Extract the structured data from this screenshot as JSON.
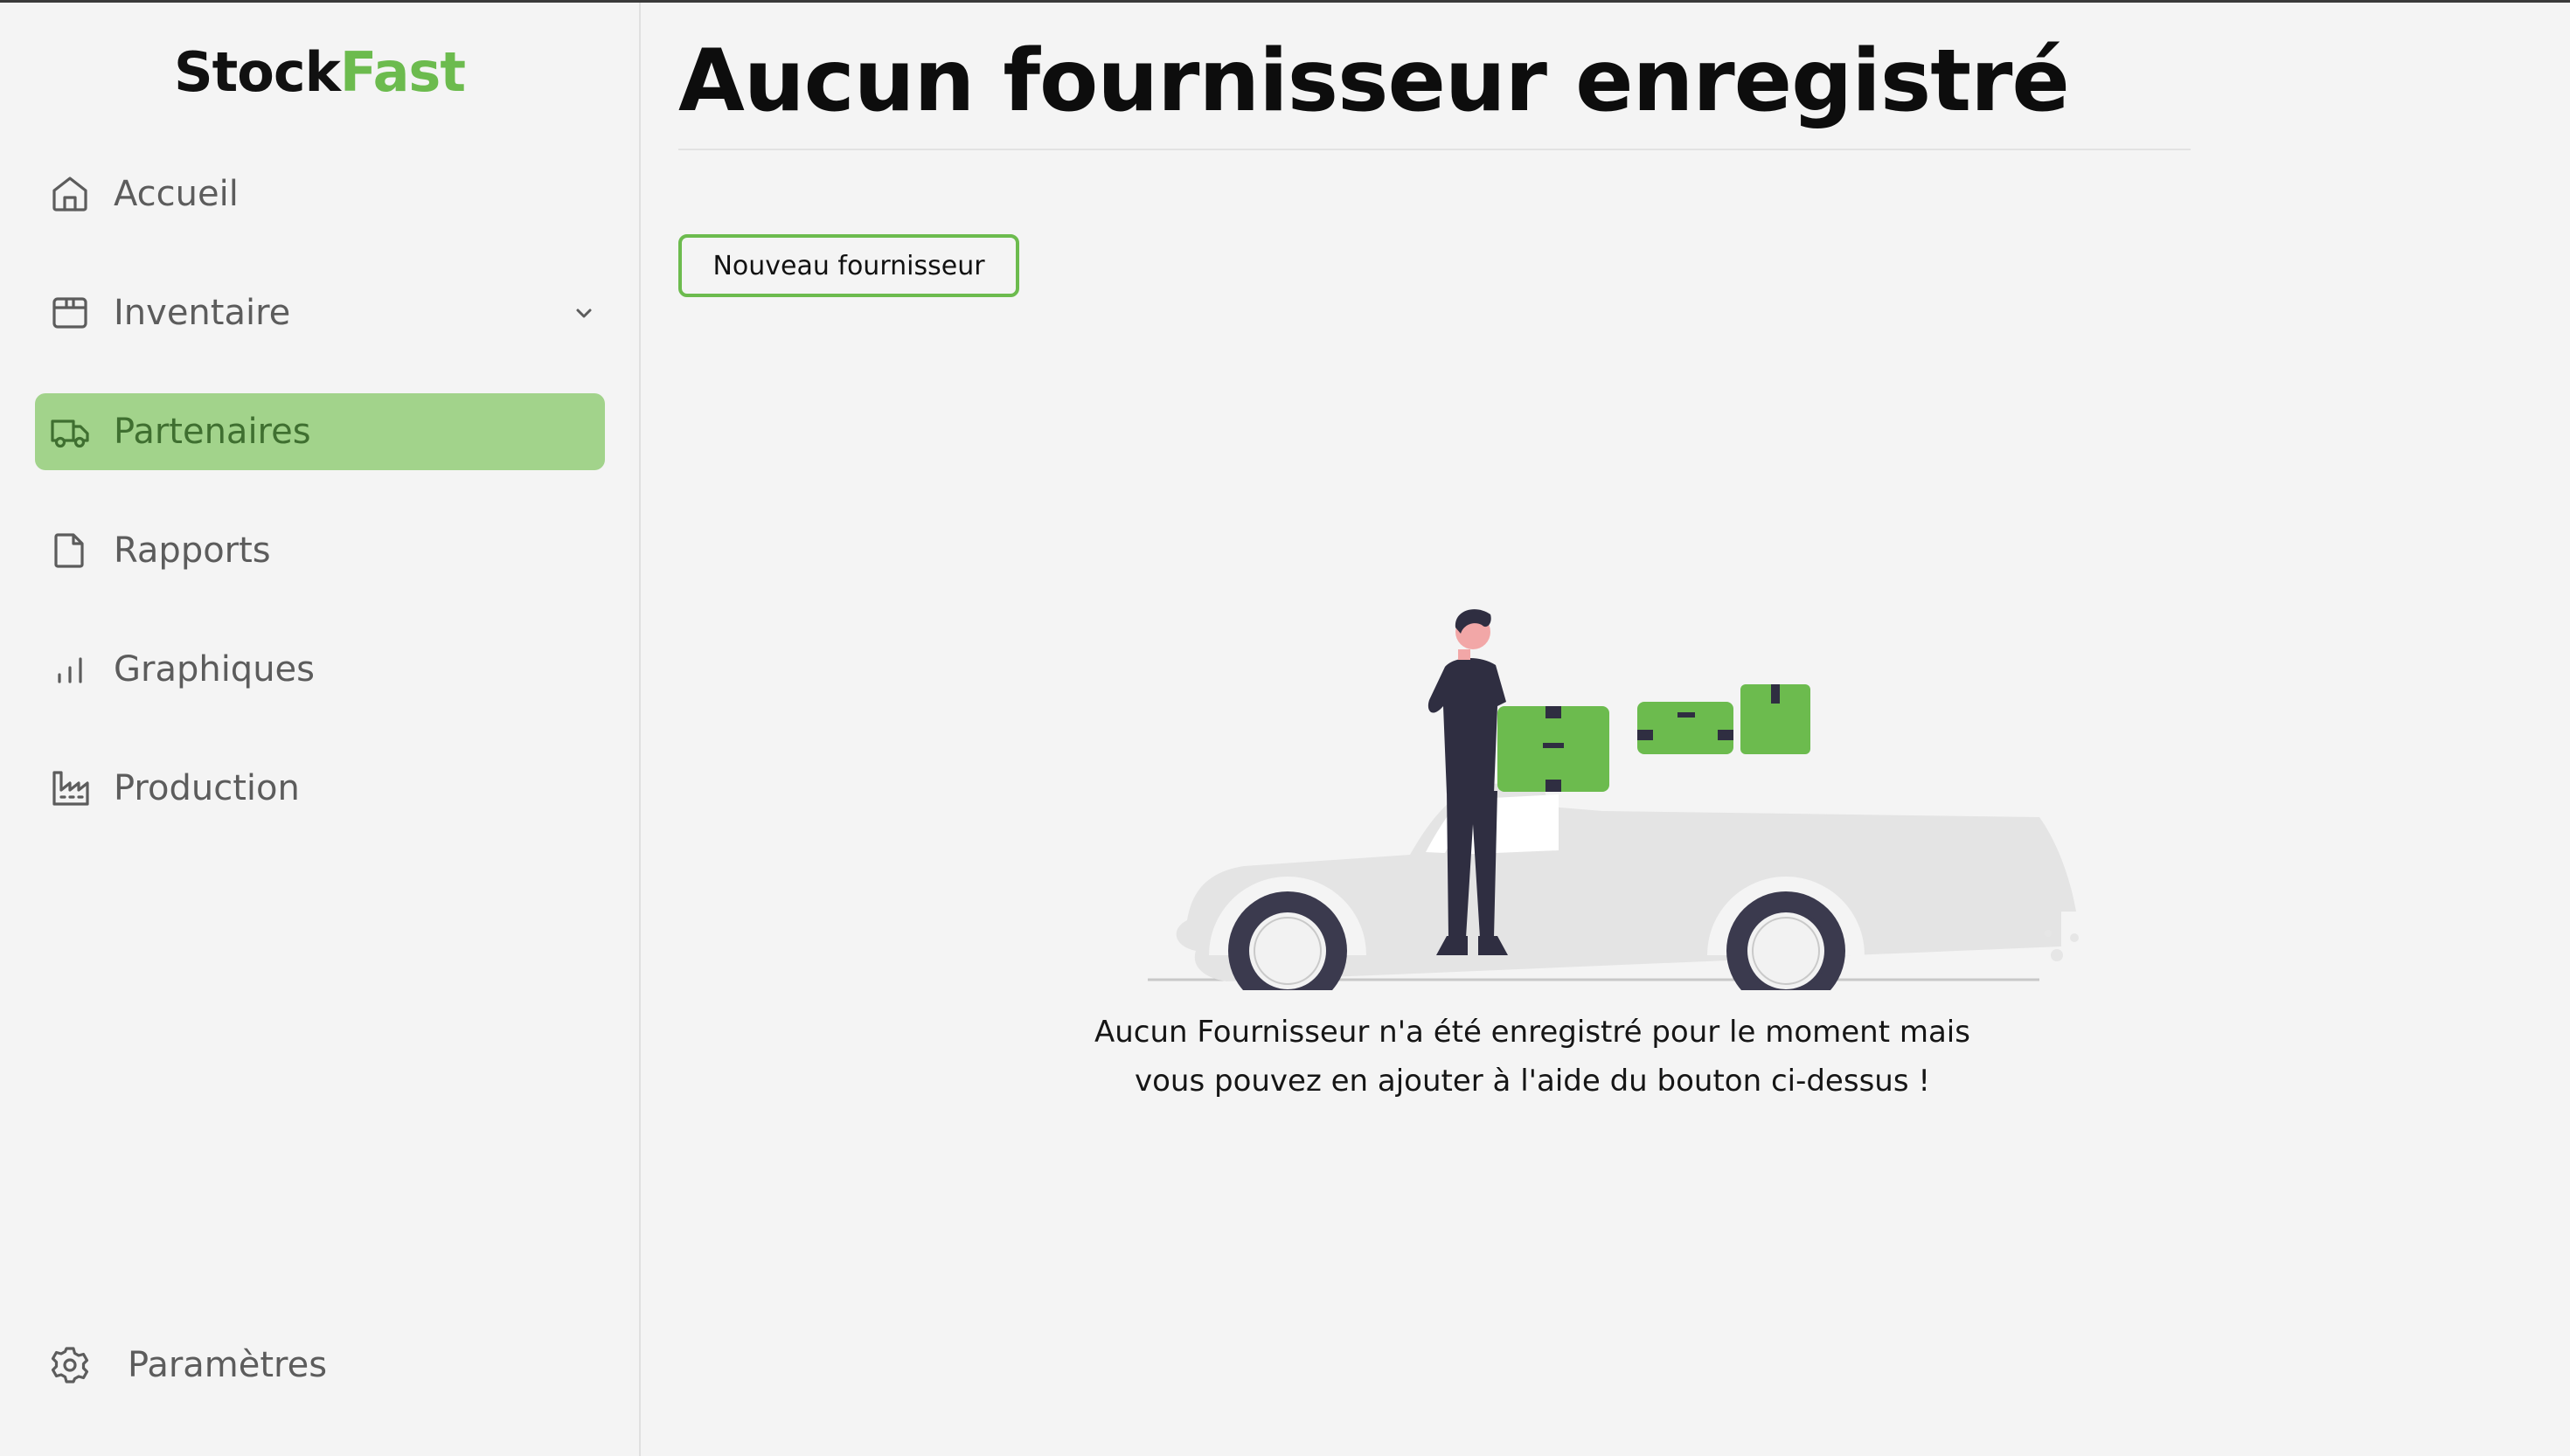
{
  "app": {
    "logo_part1": "Stock",
    "logo_part2": "Fast",
    "accent_color": "#6cbb4e",
    "active_bg_color": "#a2d38b"
  },
  "sidebar": {
    "items": [
      {
        "label": "Accueil",
        "icon": "home-icon"
      },
      {
        "label": "Inventaire",
        "icon": "box-icon",
        "has_dropdown": true
      },
      {
        "label": "Partenaires",
        "icon": "truck-icon",
        "active": true
      },
      {
        "label": "Rapports",
        "icon": "document-icon"
      },
      {
        "label": "Graphiques",
        "icon": "bar-chart-icon"
      },
      {
        "label": "Production",
        "icon": "factory-icon"
      }
    ],
    "settings": {
      "label": "Paramètres",
      "icon": "gear-icon"
    }
  },
  "main": {
    "title": "Aucun fournisseur enregistré",
    "new_button_label": "Nouveau fournisseur",
    "empty_message_line1": "Aucun Fournisseur n'a été enregistré pour le moment mais",
    "empty_message_line2": "vous pouvez en ajouter à l'aide du bouton ci-dessus !"
  }
}
